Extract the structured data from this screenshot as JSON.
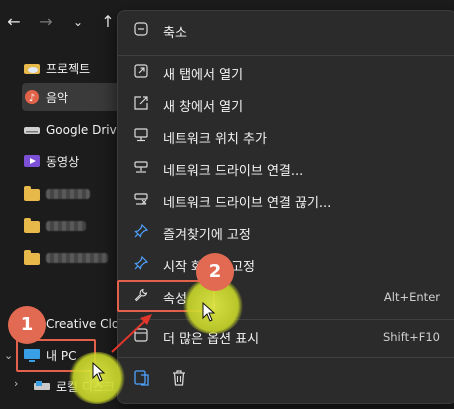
{
  "toolbar": {
    "back_icon": "←",
    "forward_icon": "→",
    "chevron_icon": "⌄",
    "up_icon": "↑"
  },
  "nav": {
    "items": [
      {
        "label": "프로젝트"
      },
      {
        "label": "음악"
      },
      {
        "label": "Google Drive"
      },
      {
        "label": "동영상"
      },
      {
        "label": ""
      },
      {
        "label": ""
      },
      {
        "label": ""
      },
      {
        "label": "Creative Clo"
      },
      {
        "label": "내 PC"
      },
      {
        "label": "로컬 디스크"
      }
    ]
  },
  "menu": {
    "items": [
      {
        "label": "축소",
        "icon": "collapse-icon",
        "shortcut": ""
      },
      {
        "label": "새 탭에서 열기",
        "icon": "new-tab-icon",
        "shortcut": ""
      },
      {
        "label": "새 창에서 열기",
        "icon": "new-window-icon",
        "shortcut": ""
      },
      {
        "label": "네트워크 위치 추가",
        "icon": "monitor-icon",
        "shortcut": ""
      },
      {
        "label": "네트워크 드라이브 연결...",
        "icon": "network-drive-icon",
        "shortcut": ""
      },
      {
        "label": "네트워크 드라이브 연결 끊기...",
        "icon": "disconnect-drive-icon",
        "shortcut": ""
      },
      {
        "label": "즐겨찾기에 고정",
        "icon": "pin-icon",
        "shortcut": ""
      },
      {
        "label": "시작 화면에 고정",
        "icon": "pin-icon",
        "shortcut": ""
      },
      {
        "label": "속성",
        "icon": "wrench-icon",
        "shortcut": "Alt+Enter"
      },
      {
        "label": "더 많은 옵션 표시",
        "icon": "more-options-icon",
        "shortcut": "Shift+F10"
      }
    ]
  },
  "annotations": {
    "badge1": "1",
    "badge2": "2",
    "accent": "#e36a52",
    "glow": "#d8e23e"
  }
}
